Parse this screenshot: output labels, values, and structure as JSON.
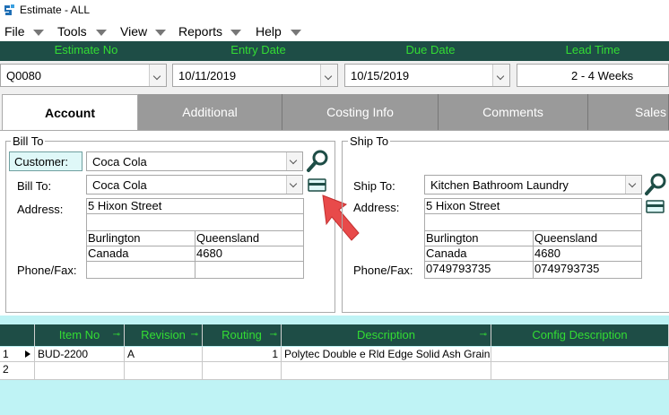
{
  "window": {
    "title": "Estimate - ALL"
  },
  "menu": [
    "File",
    "Tools",
    "View",
    "Reports",
    "Help"
  ],
  "header": {
    "estimate_no_label": "Estimate No",
    "entry_date_label": "Entry Date",
    "due_date_label": "Due Date",
    "lead_time_label": "Lead Time",
    "estimate_no": "Q0080",
    "entry_date": "10/11/2019",
    "due_date": "10/15/2019",
    "lead_time": "2 - 4 Weeks"
  },
  "tabs": [
    "Account",
    "Additional",
    "Costing Info",
    "Comments",
    "Sales"
  ],
  "bill_to": {
    "group_label": "Bill To",
    "customer_label": "Customer:",
    "customer": "Coca Cola",
    "billto_label": "Bill To:",
    "billto": "Coca Cola",
    "address_label": "Address:",
    "address1": "5 Hixon Street",
    "address2": "",
    "city": "Burlington",
    "state": "Queensland",
    "country": "Canada",
    "postcode": "4680",
    "phonefax_label": "Phone/Fax:",
    "phone": "",
    "fax": ""
  },
  "ship_to": {
    "group_label": "Ship To",
    "shipto_label": "Ship To:",
    "shipto": "Kitchen Bathroom Laundry",
    "address_label": "Address:",
    "address1": "5 Hixon Street",
    "address2": "",
    "city": "Burlington",
    "state": "Queensland",
    "country": "Canada",
    "postcode": "4680",
    "phonefax_label": "Phone/Fax:",
    "phone": "0749793735",
    "fax": "0749793735"
  },
  "grid": {
    "columns": [
      "Item No",
      "Revision",
      "Routing",
      "Description",
      "Config Description"
    ],
    "rows": [
      {
        "num": "1",
        "item_no": "BUD-2200",
        "revision": "A",
        "routing": "1",
        "description": "Polytec Double e Rld Edge Solid Ash Grain",
        "config": ""
      },
      {
        "num": "2",
        "item_no": "",
        "revision": "",
        "routing": "",
        "description": "",
        "config": ""
      }
    ]
  },
  "colors": {
    "header_bg": "#1e4d46",
    "header_text": "#33dd33",
    "accent": "#e84a4a"
  }
}
